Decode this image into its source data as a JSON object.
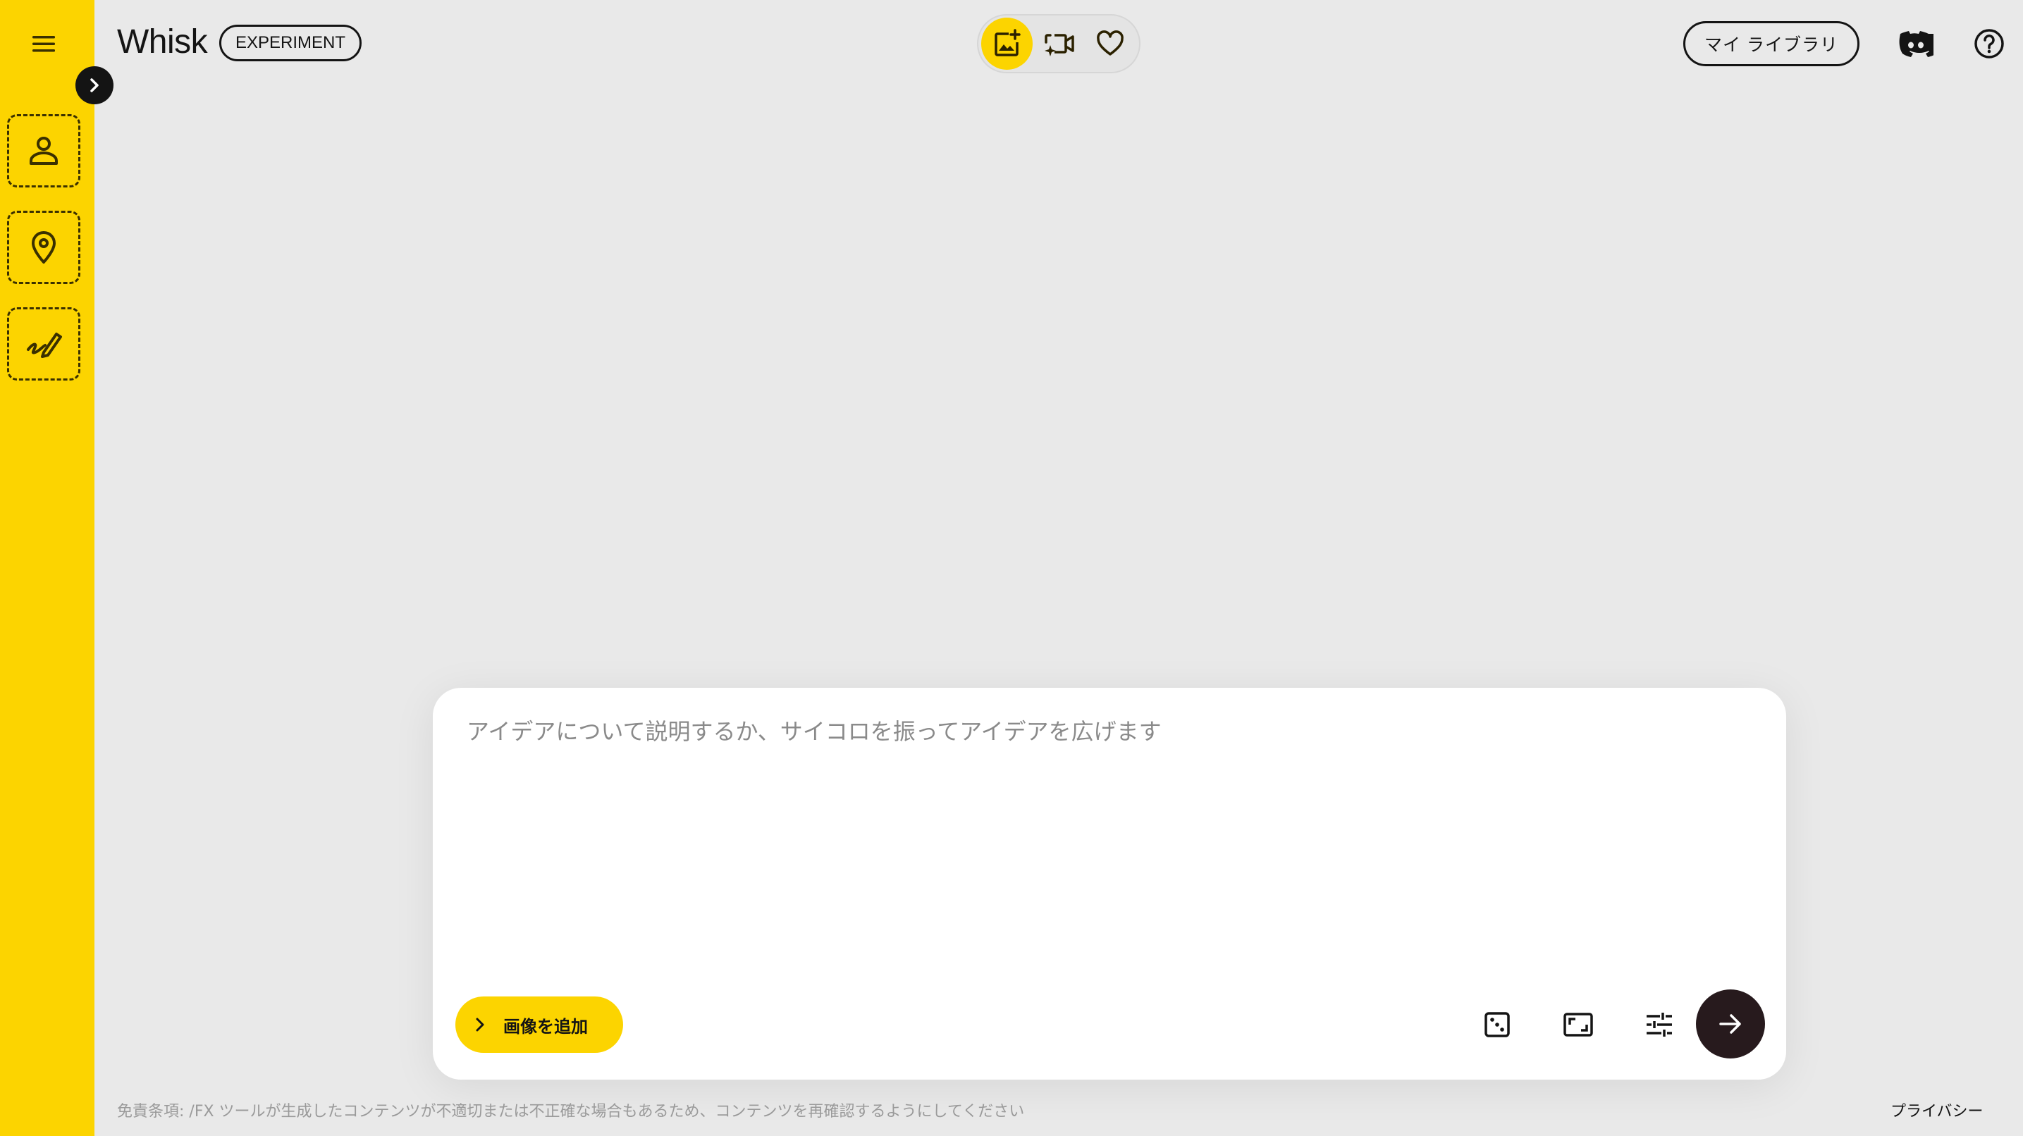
{
  "app": {
    "title": "Whisk",
    "badge": "EXPERIMENT"
  },
  "colors": {
    "accent": "#fcd400",
    "background": "#e9e9e9",
    "submit": "#271a1d"
  },
  "sidebar": {
    "menu_icon": "hamburger-menu-icon",
    "expand_icon": "chevron-right-icon",
    "slots": [
      {
        "name": "subject",
        "icon": "person-icon"
      },
      {
        "name": "scene",
        "icon": "location-pin-icon"
      },
      {
        "name": "style",
        "icon": "brush-stroke-icon"
      }
    ]
  },
  "header": {
    "modes": [
      {
        "name": "image",
        "icon": "image-sparkle-icon",
        "active": true
      },
      {
        "name": "video",
        "icon": "video-sparkle-icon",
        "active": false
      },
      {
        "name": "favorites",
        "icon": "heart-icon",
        "active": false
      }
    ],
    "library_label": "マイ ライブラリ",
    "discord_icon": "discord-icon",
    "help_icon": "help-circle-icon"
  },
  "prompt": {
    "placeholder": "アイデアについて説明するか、サイコロを振ってアイデアを広げます",
    "value": "",
    "add_image_label": "画像を追加",
    "tools": [
      {
        "name": "randomize",
        "icon": "dice-icon"
      },
      {
        "name": "aspect-ratio",
        "icon": "aspect-ratio-icon"
      },
      {
        "name": "settings",
        "icon": "tune-sliders-icon"
      }
    ],
    "submit_icon": "arrow-right-icon"
  },
  "footer": {
    "disclaimer": "免責条項: /FX ツールが生成したコンテンツが不適切または不正確な場合もあるため、コンテンツを再確認するようにしてください",
    "privacy_label": "プライバシー"
  }
}
